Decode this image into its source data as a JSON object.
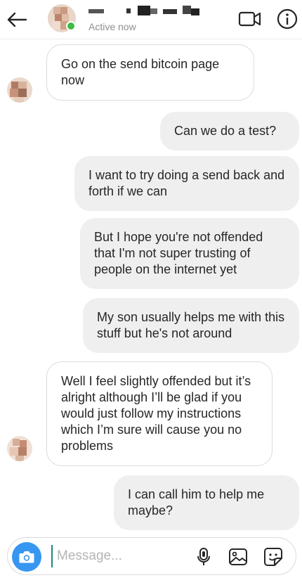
{
  "header": {
    "status": "Active now",
    "icons": {
      "back": "arrow-left-icon",
      "video": "video-call-icon",
      "info": "info-icon"
    }
  },
  "messages": [
    {
      "side": "in",
      "text": "Go on the send bitcoin page now"
    },
    {
      "side": "out",
      "text": "Can we do a test?"
    },
    {
      "side": "out",
      "text": "I want to try doing a send back and forth if we can"
    },
    {
      "side": "out",
      "text": "But I hope you're not offended that I'm not super trusting of people on the internet yet"
    },
    {
      "side": "out",
      "text": "My son usually helps me with this stuff but he's not around"
    },
    {
      "side": "in",
      "text": "Well I feel slightly offended but it’s alright although I’ll be glad if you would just follow my instructions which I’m sure will cause you no problems"
    },
    {
      "side": "out",
      "text": "I can call him to help me maybe?"
    }
  ],
  "composer": {
    "placeholder": "Message...",
    "icons": {
      "camera": "camera-icon",
      "mic": "microphone-icon",
      "gallery": "image-icon",
      "sticker": "sticker-icon"
    }
  },
  "colors": {
    "camera_button": "#3797f0",
    "online": "#3fbb46",
    "outgoing_bubble": "#efefef"
  }
}
